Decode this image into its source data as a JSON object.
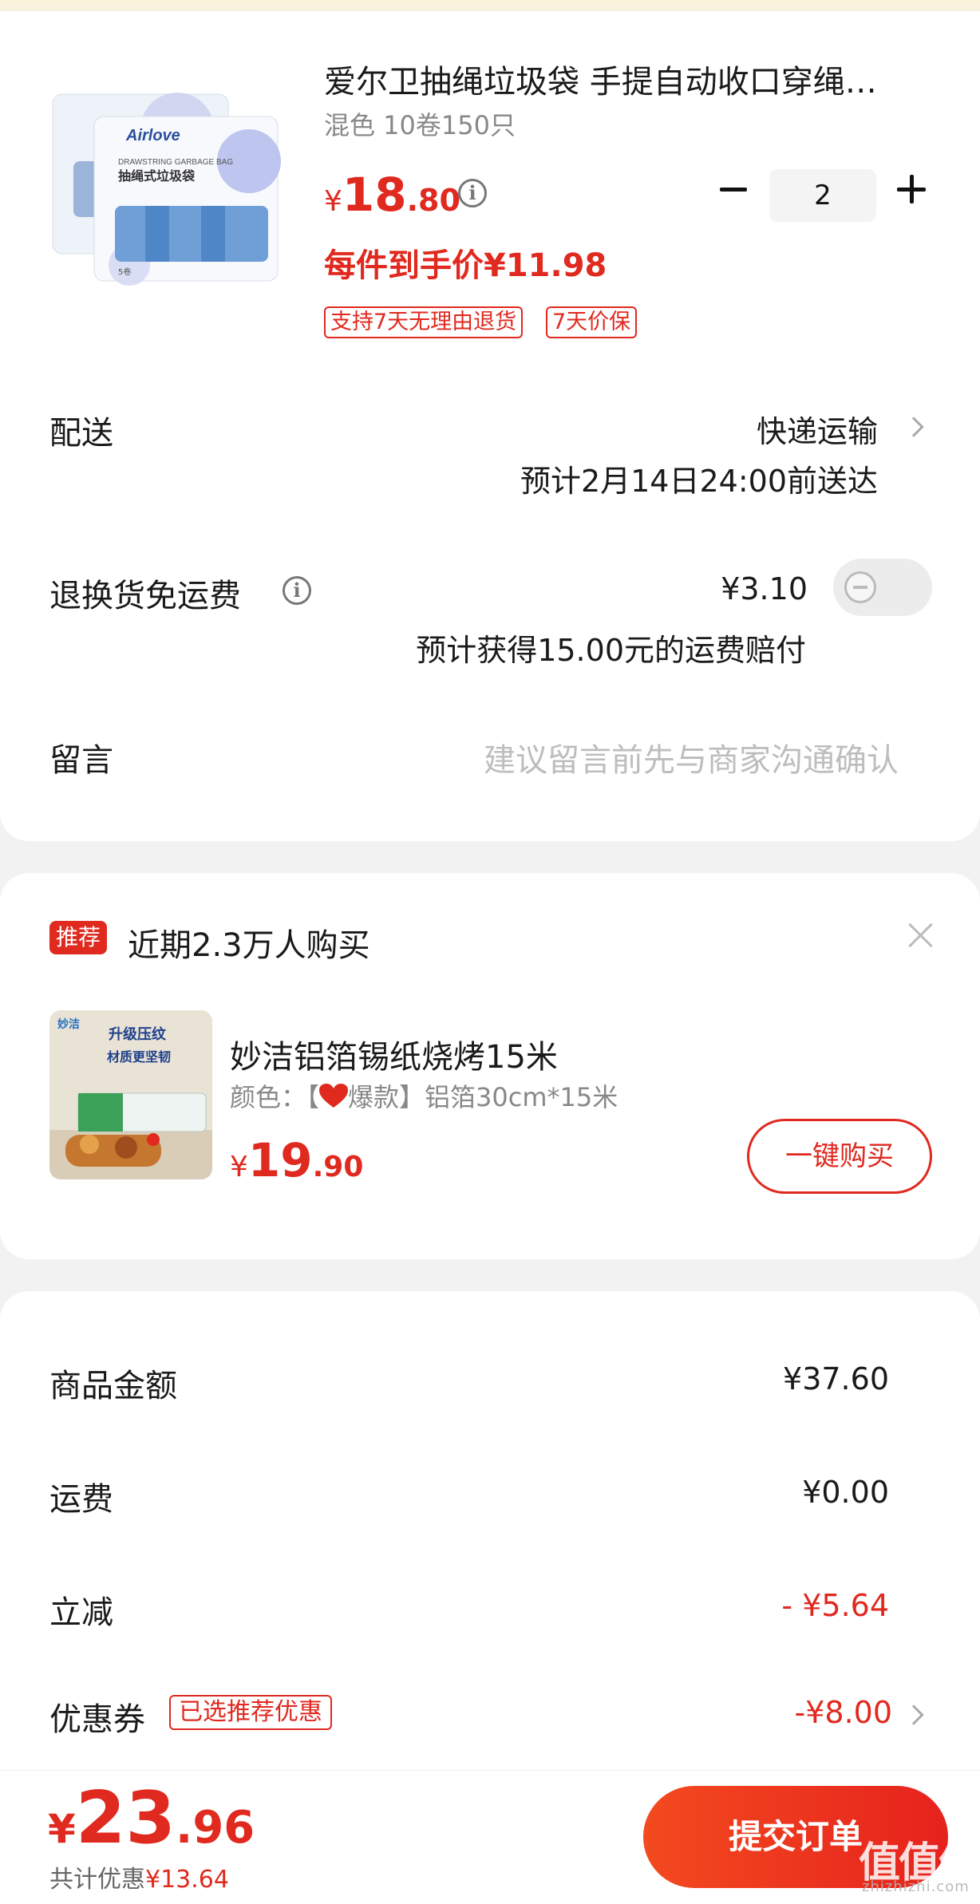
{
  "product": {
    "title": "爱尔卫抽绳垃圾袋 手提自动收口穿绳…",
    "spec": "混色 10卷150只",
    "price_symbol": "¥",
    "price_int": "18",
    "price_dec": ".80",
    "quantity": "2",
    "unit_price": "每件到手价¥11.98",
    "tags": [
      "支持7天无理由退货",
      "7天价保"
    ],
    "image": {
      "brand": "Airlove",
      "line1": "DRAWSTRING GARBAGE BAG",
      "line2": "抽绳式垃圾袋",
      "count": "5卷"
    }
  },
  "delivery": {
    "label": "配送",
    "method": "快递运输",
    "eta": "预计2月14日24:00前送达"
  },
  "return_shipping": {
    "label": "退换货免运费",
    "price": "¥3.10",
    "note": "预计获得15.00元的运费赔付",
    "enabled": false
  },
  "message": {
    "label": "留言",
    "placeholder": "建议留言前先与商家沟通确认"
  },
  "recommendation": {
    "badge": "推荐",
    "heading": "近期2.3万人购买",
    "title": "妙洁铝箔锡纸烧烤15米",
    "spec_prefix": "颜色：【",
    "spec_suffix": "爆款】铝箔30cm*15米",
    "price_symbol": "¥",
    "price_int": "19",
    "price_dec": ".90",
    "buy_label": "一键购买",
    "image": {
      "brand": "妙洁",
      "line1": "升级压纹",
      "line2": "材质更坚韧"
    }
  },
  "summary": {
    "rows": [
      {
        "label": "商品金额",
        "value": "¥37.60"
      },
      {
        "label": "运费",
        "value": "¥0.00"
      },
      {
        "label": "立减",
        "value": "- ¥5.64"
      },
      {
        "label": "优惠券",
        "tag": "已选推荐优惠",
        "value": "-¥8.00"
      }
    ]
  },
  "footer": {
    "total_symbol": "¥",
    "total_int": "23",
    "total_dec": ".96",
    "discount": "共计优惠¥13.64",
    "submit_label": "提交订单",
    "watermark": "值值值",
    "watermark_sub": "zhizhizhi.com"
  },
  "colors": {
    "accent": "#e0291f",
    "background": "#f2f2f2",
    "card": "#ffffff"
  }
}
